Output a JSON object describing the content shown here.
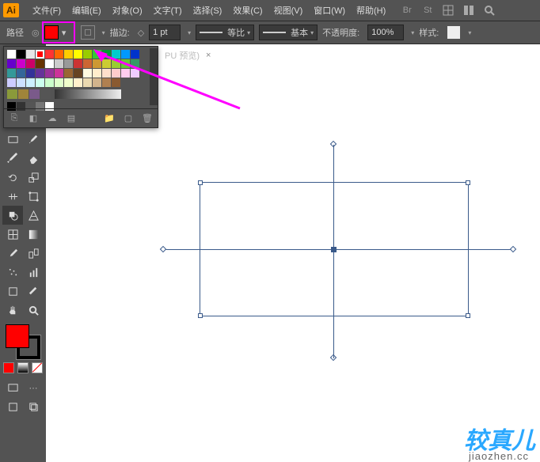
{
  "menu": {
    "items": [
      "文件(F)",
      "编辑(E)",
      "对象(O)",
      "文字(T)",
      "选择(S)",
      "效果(C)",
      "视图(V)",
      "窗口(W)",
      "帮助(H)"
    ]
  },
  "options": {
    "path_label": "路径",
    "stroke_label": "描边:",
    "stroke_width": "1 pt",
    "scale_label": "等比",
    "profile_label": "基本",
    "opacity_label": "不透明度:",
    "opacity_value": "100%",
    "style_label": "样式:",
    "fill_color": "#ff0000"
  },
  "tab": {
    "label": "PU 预览)",
    "close": "×"
  },
  "swatches": {
    "selected": "#ff0000",
    "row1": [
      "#ffffff",
      "#000000",
      "#e6e6e6",
      "#ff0000",
      "#ff3333",
      "#ff6600",
      "#ffcc00",
      "#ffff00",
      "#99cc00",
      "#33cc33",
      "#009933",
      "#00cccc",
      "#0099ff",
      "#0033cc",
      "#6600cc",
      "#cc00cc",
      "#cc0066",
      "#663300"
    ],
    "row2": [
      "#ffffff",
      "#cccccc",
      "#999999",
      "#cc3333",
      "#cc6633",
      "#cc9933",
      "#cccc33",
      "#99cc33",
      "#66cc33",
      "#339966",
      "#339999",
      "#336699",
      "#333399",
      "#663399",
      "#993399",
      "#cc3399",
      "#996633",
      "#664422"
    ],
    "row3": [
      "#fffbe0",
      "#ffeecc",
      "#ffe0cc",
      "#ffcccc",
      "#ffccee",
      "#eeccff",
      "#ccccff",
      "#cce0ff",
      "#ccf0ff",
      "#ccffee",
      "#ccffcc",
      "#e0ffcc",
      "#f0ffcc",
      "#fff0cc",
      "#ead9b0",
      "#d2b48c",
      "#b08050",
      "#8a5a30"
    ],
    "folders": [
      "#8a9a3a",
      "#a0843a",
      "#7a5a8a",
      "#555555"
    ],
    "bottom_row": [
      "#000000",
      "#333333",
      "#555555",
      "#777777",
      "#ffffff"
    ]
  },
  "watermark": {
    "main": "较真儿",
    "sub": "jiaozhen.cc"
  }
}
